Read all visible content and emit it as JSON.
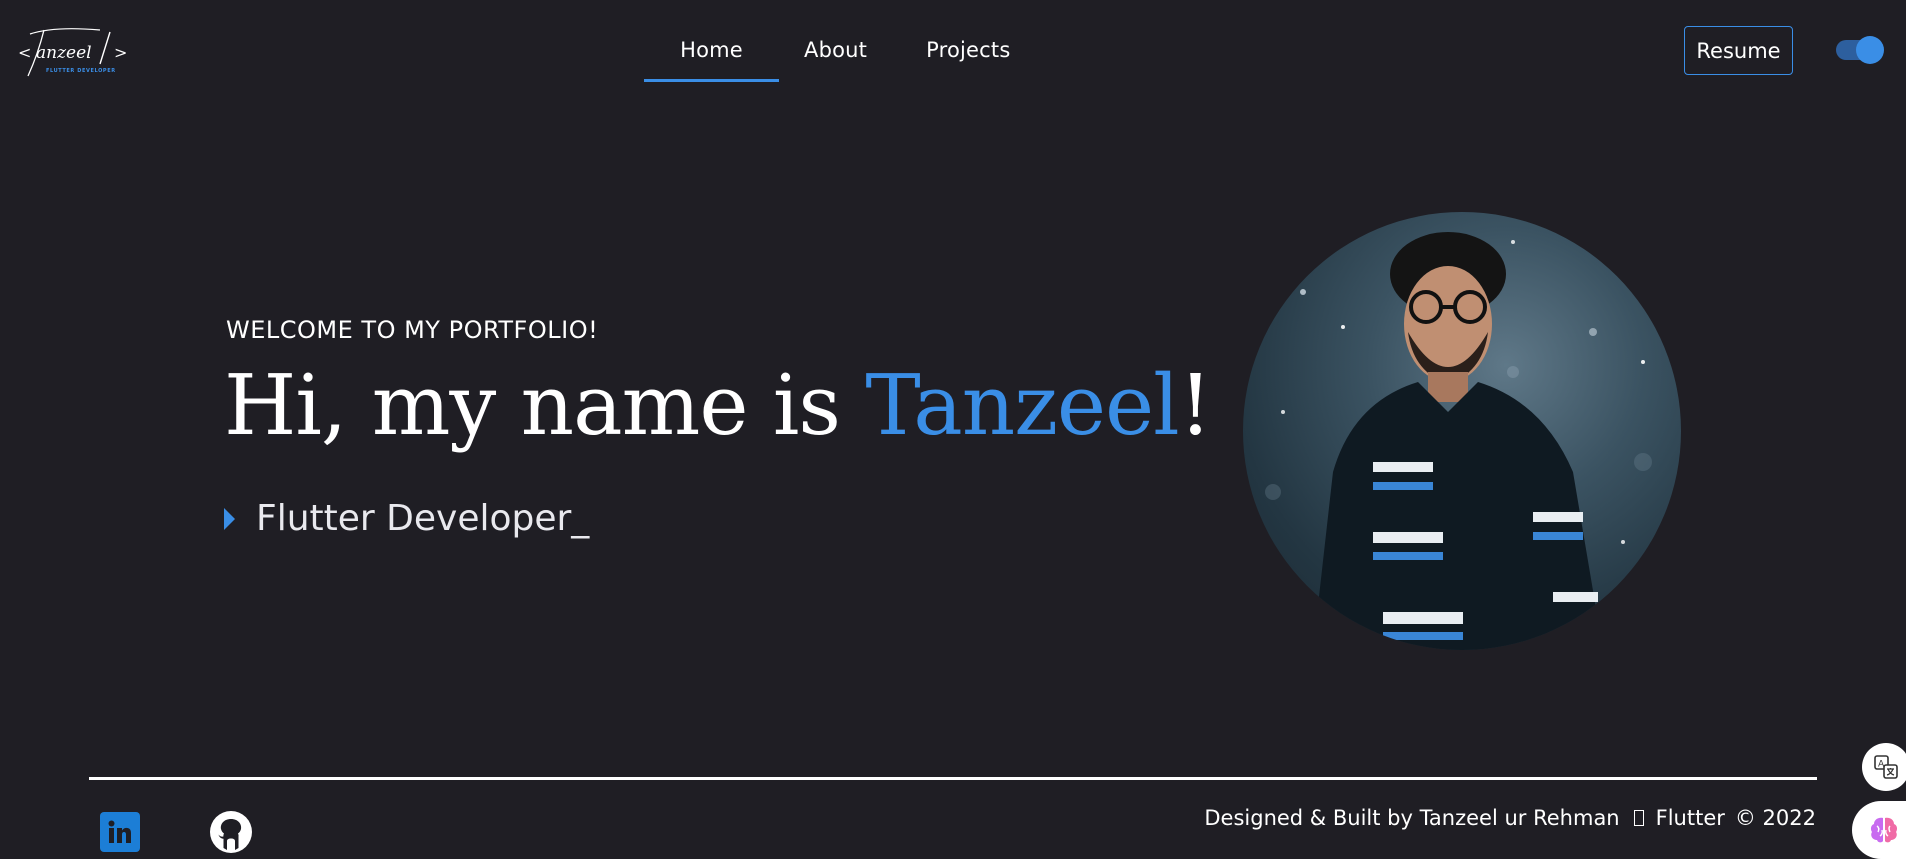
{
  "header": {
    "logo_text": "Tanzeel",
    "logo_subtitle": "FLUTTER DEVELOPER",
    "nav": [
      {
        "label": "Home",
        "active": true
      },
      {
        "label": "About",
        "active": false
      },
      {
        "label": "Projects",
        "active": false
      }
    ],
    "resume_label": "Resume",
    "theme_toggle": {
      "state": "on"
    }
  },
  "hero": {
    "welcome": "WELCOME TO MY PORTFOLIO!",
    "title_prefix": "Hi, my name is ",
    "title_name": "Tanzeel",
    "title_suffix": "!",
    "role": "Flutter Developer_"
  },
  "footer": {
    "social": [
      {
        "icon": "linkedin-icon"
      },
      {
        "icon": "github-icon"
      }
    ],
    "credits_text": "Designed & Built by Tanzeel ur Rehman",
    "credits_tech": "Flutter",
    "credits_year": "© 2022"
  },
  "colors": {
    "background": "#1f1e24",
    "accent": "#3a8ee6",
    "text": "#ffffff"
  }
}
